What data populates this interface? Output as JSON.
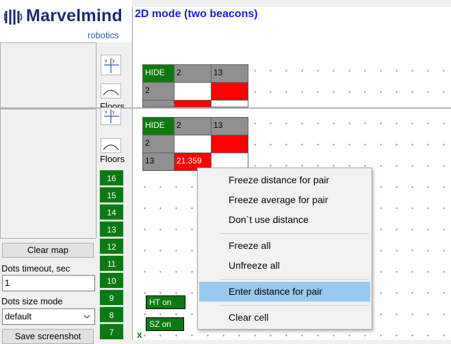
{
  "logo": {
    "word": "Marvelmind",
    "sub": "robotics"
  },
  "header": {
    "title": "2D mode (two beacons)"
  },
  "floors_label": "Floors",
  "floors": [
    "16",
    "15",
    "14",
    "13",
    "12",
    "11",
    "10",
    "9",
    "8",
    "7"
  ],
  "matrix_back": {
    "hide": "HIDE",
    "col1": "2",
    "col2": "13",
    "row1": "2"
  },
  "matrix_front": {
    "hide": "HIDE",
    "col1": "2",
    "col2": "13",
    "row1": "2",
    "row2": "13",
    "value": "21.359"
  },
  "left": {
    "clear_map": "Clear map",
    "dots_timeout_label": "Dots timeout, sec",
    "dots_timeout_value": "1",
    "dots_size_label": "Dots size mode",
    "dots_size_value": "default",
    "save_screenshot": "Save screenshot"
  },
  "tags": {
    "ht": "HT on",
    "sz": "SZ on"
  },
  "context_menu": [
    "Freeze distance for pair",
    "Freeze average for pair",
    "Don`t use distance",
    "Freeze all",
    "Unfreeze all",
    "Enter distance for pair",
    "Clear cell"
  ],
  "colors": {
    "green": "#0b7a12",
    "red": "#ff0000",
    "highlight": "#99c9ef",
    "title_blue": "#1b1bd6"
  }
}
